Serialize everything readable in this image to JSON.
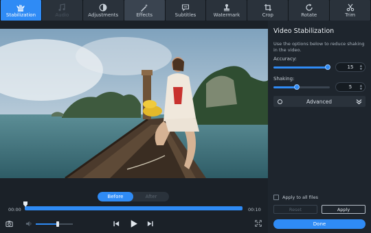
{
  "toolbar": {
    "tools": [
      {
        "label": "Stabilization",
        "icon": "hand-stabilization-icon",
        "state": "active"
      },
      {
        "label": "Audio",
        "icon": "music-note-icon",
        "state": "disabled"
      },
      {
        "label": "Adjustments",
        "icon": "contrast-circle-icon",
        "state": "normal"
      },
      {
        "label": "Effects",
        "icon": "magic-wand-icon",
        "state": "hovered"
      },
      {
        "label": "Subtitles",
        "icon": "speech-bubble-icon",
        "state": "normal"
      },
      {
        "label": "Watermark",
        "icon": "stamp-icon",
        "state": "normal"
      },
      {
        "label": "Crop",
        "icon": "crop-icon",
        "state": "normal"
      },
      {
        "label": "Rotate",
        "icon": "rotate-icon",
        "state": "normal"
      },
      {
        "label": "Trim",
        "icon": "scissors-icon",
        "state": "normal"
      }
    ]
  },
  "panel": {
    "title": "Video Stabilization",
    "description": "Use the options below to reduce shaking in the video.",
    "accuracy": {
      "label": "Accuracy:",
      "value": "15",
      "fraction": 0.96
    },
    "shaking": {
      "label": "Shaking:",
      "value": "5",
      "fraction": 0.42
    },
    "advanced_label": "Advanced",
    "apply_all_label": "Apply to all files",
    "reset_label": "Reset",
    "apply_label": "Apply",
    "done_label": "Done"
  },
  "player": {
    "before_label": "Before",
    "after_label": "After",
    "time_start": "00:00",
    "time_end": "00:10",
    "volume_fraction": 0.6
  },
  "colors": {
    "accent": "#2f8bf5",
    "background": "#1b2128",
    "panel": "#1e252d"
  }
}
